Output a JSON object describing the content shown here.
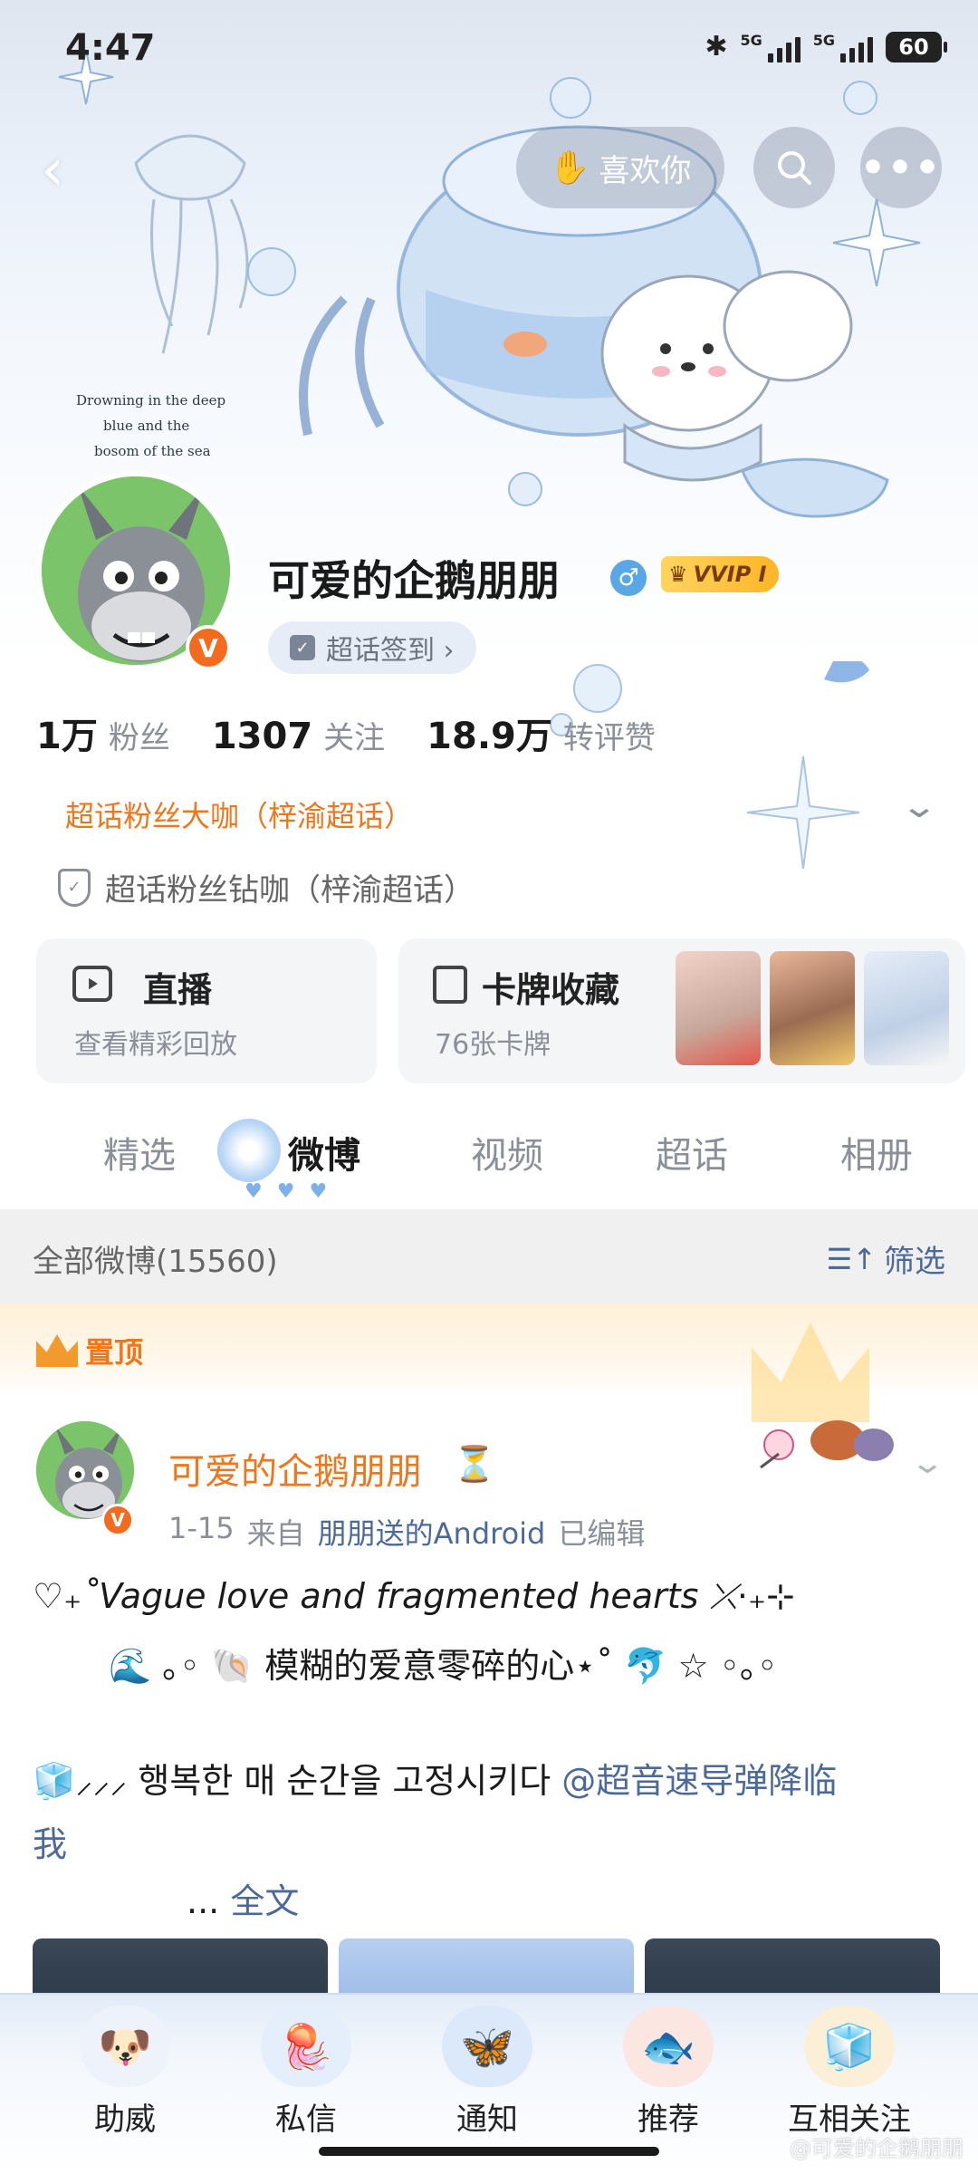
{
  "status_bar": {
    "time": "4:47",
    "bluetooth_icon": "bluetooth-icon",
    "signal1_label": "5G",
    "signal2_label": "5G",
    "battery": "60"
  },
  "header": {
    "back_icon": "back-arrow-icon",
    "like_label": "喜欢你",
    "like_icon": "hand-icon",
    "search_icon": "search-icon",
    "more_icon": "more-icon",
    "cover_text_1": "Drowning in the deep",
    "cover_text_2": "blue and the",
    "cover_text_3": "bosom of the sea"
  },
  "profile": {
    "name": "可爱的企鹅朋朋",
    "gender_symbol": "♂",
    "vip_label": "VVIP I",
    "verified_badge": "V",
    "checkin_label": "超话签到 ›",
    "stats": [
      {
        "num": "1万",
        "label": "粉丝"
      },
      {
        "num": "1307",
        "label": "关注"
      },
      {
        "num": "18.9万",
        "label": "转评赞"
      }
    ],
    "fan_title": "超话粉丝大咖（梓渝超话）",
    "fan_sub": "超话粉丝钻咖（梓渝超话）"
  },
  "cards": {
    "live": {
      "title": "直播",
      "sub": "查看精彩回放"
    },
    "collection": {
      "title": "卡牌收藏",
      "sub": "76张卡牌"
    }
  },
  "tabs": [
    "精选",
    "微博",
    "视频",
    "超话",
    "相册"
  ],
  "filter": {
    "left": "全部微博(15560)",
    "right": "筛选",
    "right_icon": "filter-icon"
  },
  "pinned": {
    "label": "置顶"
  },
  "post": {
    "name": "可爱的企鹅朋朋",
    "hourglass": "⏳",
    "verified": "V",
    "date": "1-15",
    "from": "来自",
    "source": "朋朋送的Android",
    "edited": "已编辑",
    "line1": "♡₊˚Vague love and fragmented hearts ⤫⋅₊⊹",
    "line2": "🌊 ｡◦ 🐚 模糊的爱意零碎的心⋆˚ 🐬 ☆ ◦｡◦",
    "line3_prefix": "🧊⸝⸝⸝ 행복한 매 순간을 고정시키다 ",
    "line3_mention": "@超音速导弹降临",
    "line4": "我",
    "line5_dots": "... ",
    "line5_full": "全文"
  },
  "bottom_bar": [
    {
      "label": "助威",
      "icon": "dog-icon"
    },
    {
      "label": "私信",
      "icon": "jellyfish-icon"
    },
    {
      "label": "通知",
      "icon": "butterfly-icon"
    },
    {
      "label": "推荐",
      "icon": "fish-icon"
    },
    {
      "label": "互相关注",
      "icon": "cube-icon"
    }
  ],
  "watermark": "@可爱的企鹅朋朋"
}
